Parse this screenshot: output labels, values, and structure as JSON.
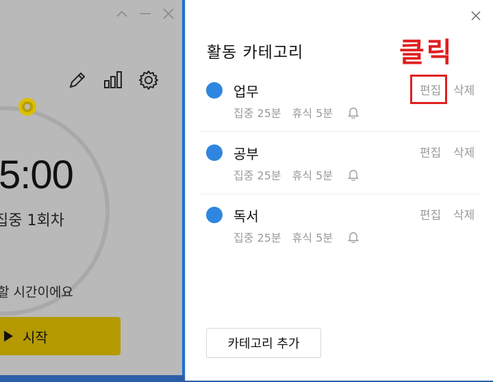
{
  "timer": {
    "time": "5:00",
    "session": "집중 1회차",
    "hint": "할 시간이에요",
    "start_label": "시작"
  },
  "panel": {
    "title": "활동 카테고리",
    "annotation": "클릭",
    "add_label": "카테고리 추가"
  },
  "categories": [
    {
      "name": "업무",
      "focus": "집중 25분",
      "rest": "휴식 5분",
      "edit": "편집",
      "delete": "삭제",
      "color": "#2f86e0"
    },
    {
      "name": "공부",
      "focus": "집중 25분",
      "rest": "휴식 5분",
      "edit": "편집",
      "delete": "삭제",
      "color": "#2f86e0"
    },
    {
      "name": "독서",
      "focus": "집중 25분",
      "rest": "휴식 5분",
      "edit": "편집",
      "delete": "삭제",
      "color": "#2f86e0"
    }
  ],
  "icons": {
    "minimize": "minimize-icon",
    "maximize": "chevron-up-icon",
    "close": "close-icon",
    "edit": "pencil-icon",
    "stats": "bar-chart-icon",
    "settings": "gear-icon",
    "notify": "bell-icon",
    "play": "play-icon"
  },
  "colors": {
    "accent": "#2f86e0",
    "start_button": "#b49a00",
    "annotation": "#e02020"
  }
}
